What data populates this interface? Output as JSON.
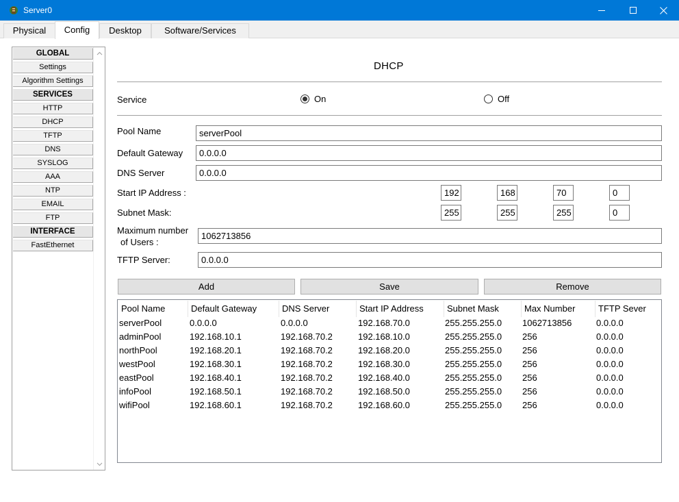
{
  "window": {
    "title": "Server0"
  },
  "tabs": [
    {
      "label": "Physical"
    },
    {
      "label": "Config"
    },
    {
      "label": "Desktop"
    },
    {
      "label": "Software/Services"
    }
  ],
  "nav": {
    "items": [
      {
        "label": "GLOBAL"
      },
      {
        "label": "Settings"
      },
      {
        "label": "Algorithm Settings"
      },
      {
        "label": "SERVICES"
      },
      {
        "label": "HTTP"
      },
      {
        "label": "DHCP"
      },
      {
        "label": "TFTP"
      },
      {
        "label": "DNS"
      },
      {
        "label": "SYSLOG"
      },
      {
        "label": "AAA"
      },
      {
        "label": "NTP"
      },
      {
        "label": "EMAIL"
      },
      {
        "label": "FTP"
      },
      {
        "label": "INTERFACE"
      },
      {
        "label": "FastEthernet"
      }
    ]
  },
  "dhcp": {
    "heading": "DHCP",
    "service_label": "Service",
    "on_label": "On",
    "off_label": "Off",
    "service_state": "On",
    "pool_name_label": "Pool Name",
    "pool_name_value": "serverPool",
    "default_gateway_label": "Default Gateway",
    "default_gateway_value": "0.0.0.0",
    "dns_server_label": "DNS Server",
    "dns_server_value": "0.0.0.0",
    "start_ip_label": "Start IP Address :",
    "start_ip_octets": [
      "192",
      "168",
      "70",
      "0"
    ],
    "subnet_mask_label": "Subnet Mask:",
    "subnet_mask_octets": [
      "255",
      "255",
      "255",
      "0"
    ],
    "max_users_label_line1": "Maximum number",
    "max_users_label_line2": "of Users :",
    "max_users_value": "1062713856",
    "tftp_server_label": "TFTP Server:",
    "tftp_server_value": "0.0.0.0",
    "add_label": "Add",
    "save_label": "Save",
    "remove_label": "Remove"
  },
  "pool_table": {
    "columns": [
      "Pool Name",
      "Default Gateway",
      "DNS Server",
      "Start IP Address",
      "Subnet Mask",
      "Max Number",
      "TFTP Sever"
    ],
    "rows": [
      [
        "serverPool",
        "0.0.0.0",
        "0.0.0.0",
        "192.168.70.0",
        "255.255.255.0",
        "1062713856",
        "0.0.0.0"
      ],
      [
        "adminPool",
        "192.168.10.1",
        "192.168.70.2",
        "192.168.10.0",
        "255.255.255.0",
        "256",
        "0.0.0.0"
      ],
      [
        "northPool",
        "192.168.20.1",
        "192.168.70.2",
        "192.168.20.0",
        "255.255.255.0",
        "256",
        "0.0.0.0"
      ],
      [
        "westPool",
        "192.168.30.1",
        "192.168.70.2",
        "192.168.30.0",
        "255.255.255.0",
        "256",
        "0.0.0.0"
      ],
      [
        "eastPool",
        "192.168.40.1",
        "192.168.70.2",
        "192.168.40.0",
        "255.255.255.0",
        "256",
        "0.0.0.0"
      ],
      [
        "infoPool",
        "192.168.50.1",
        "192.168.70.2",
        "192.168.50.0",
        "255.255.255.0",
        "256",
        "0.0.0.0"
      ],
      [
        "wifiPool",
        "192.168.60.1",
        "192.168.70.2",
        "192.168.60.0",
        "255.255.255.0",
        "256",
        "0.0.0.0"
      ]
    ]
  }
}
